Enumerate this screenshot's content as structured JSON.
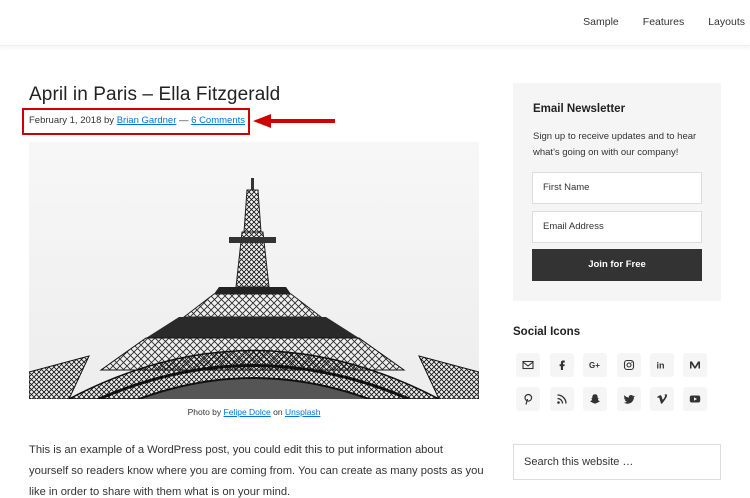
{
  "nav": {
    "items": [
      "Sample",
      "Features",
      "Layouts"
    ]
  },
  "post": {
    "title": "April in Paris – Ella Fitzgerald",
    "date": "February 1, 2018",
    "by": "by",
    "author": "Brian Gardner",
    "separator": "—",
    "comments": "6 Comments",
    "caption_prefix": "Photo by",
    "caption_author": "Felipe Dolce",
    "caption_on": "on",
    "caption_source": "Unsplash",
    "body": "This is an example of a WordPress post, you could edit this to put information about yourself so readers know where you are coming from. You can create as many posts as you like in order to share with them what is on your mind."
  },
  "newsletter": {
    "title": "Email Newsletter",
    "description": "Sign up to receive updates and to hear what's going on with our company!",
    "first_name_placeholder": "First Name",
    "email_placeholder": "Email Address",
    "button": "Join for Free"
  },
  "social": {
    "title": "Social Icons",
    "icons": [
      "email-icon",
      "facebook-icon",
      "google-plus-icon",
      "instagram-icon",
      "linkedin-icon",
      "medium-icon",
      "pinterest-icon",
      "rss-icon",
      "snapchat-icon",
      "twitter-icon",
      "vimeo-icon",
      "youtube-icon"
    ]
  },
  "search": {
    "placeholder": "Search this website …"
  },
  "colors": {
    "link": "#0073e5",
    "highlight": "#d10000",
    "button_bg": "#333333",
    "widget_bg": "#f5f5f5"
  }
}
